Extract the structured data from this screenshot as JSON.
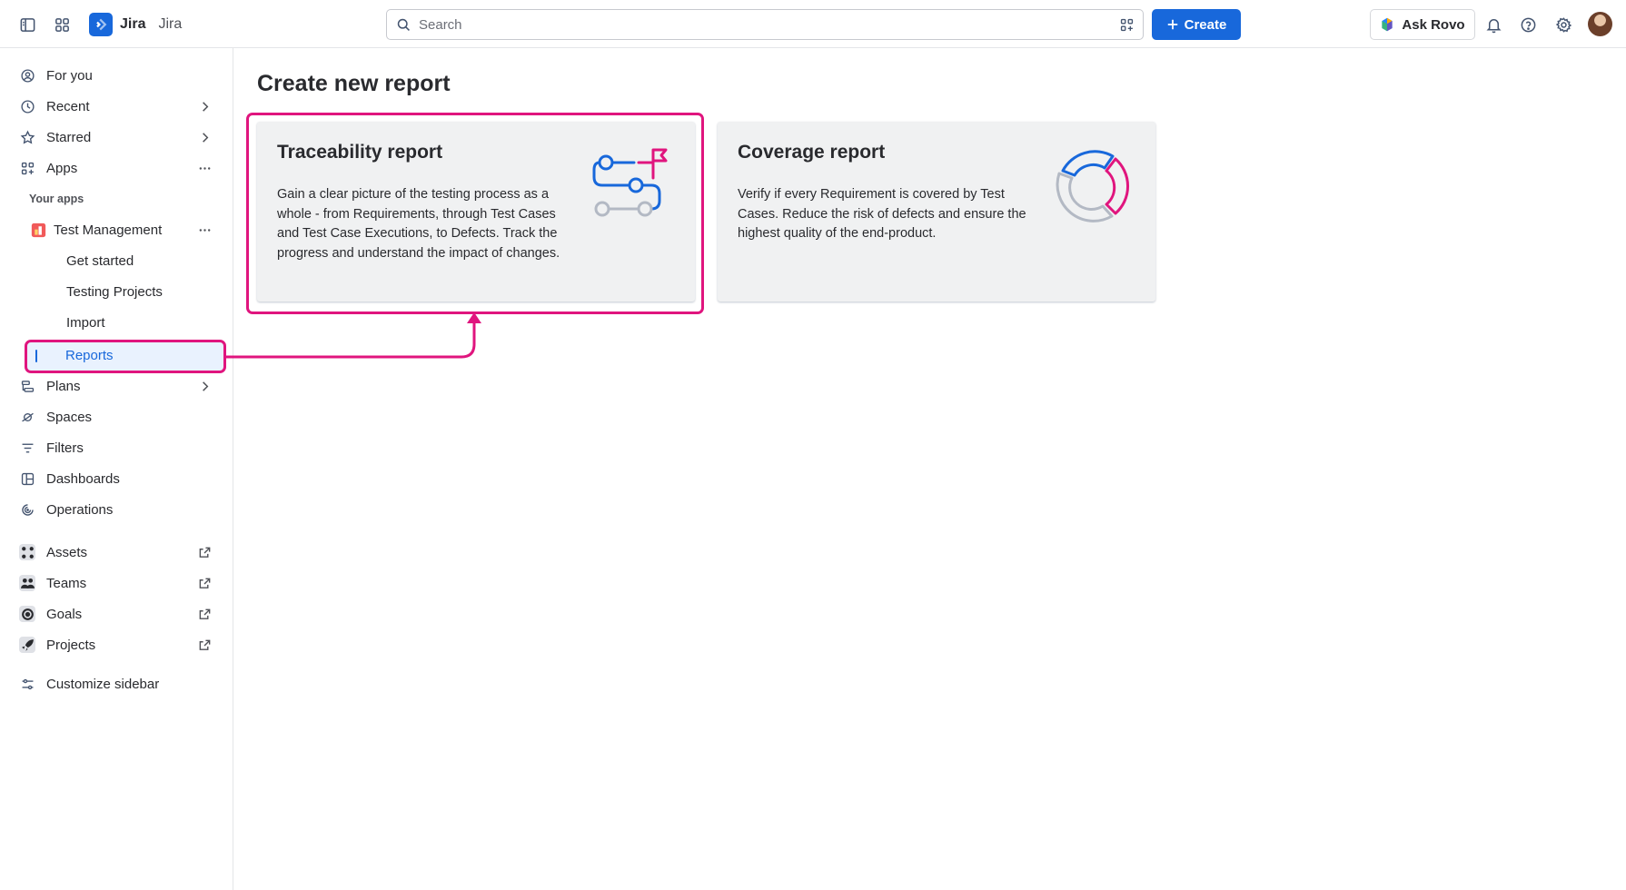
{
  "topbar": {
    "brand_name": "Jira",
    "brand_sub": "Jira",
    "search_placeholder": "Search",
    "create_label": "Create",
    "rovo_label": "Ask Rovo"
  },
  "sidebar": {
    "items": [
      {
        "label": "For you",
        "icon": "person-circle-icon"
      },
      {
        "label": "Recent",
        "icon": "clock-icon"
      },
      {
        "label": "Starred",
        "icon": "star-icon"
      },
      {
        "label": "Apps",
        "icon": "apps-icon"
      },
      {
        "label": "Plans",
        "icon": "plans-icon"
      },
      {
        "label": "Spaces",
        "icon": "spaces-icon"
      },
      {
        "label": "Filters",
        "icon": "filter-icon"
      },
      {
        "label": "Dashboards",
        "icon": "dashboard-icon"
      },
      {
        "label": "Operations",
        "icon": "operations-icon"
      },
      {
        "label": "Assets",
        "icon": "assets-icon"
      },
      {
        "label": "Teams",
        "icon": "teams-icon"
      },
      {
        "label": "Goals",
        "icon": "goals-icon"
      },
      {
        "label": "Projects",
        "icon": "rocket-icon"
      },
      {
        "label": "Customize sidebar",
        "icon": "sliders-icon"
      }
    ],
    "your_apps_label": "Your apps",
    "app_name": "Test Management",
    "app_subitems": [
      "Get started",
      "Testing Projects",
      "Import",
      "Reports"
    ]
  },
  "main": {
    "title": "Create new report",
    "cards": [
      {
        "title": "Traceability report",
        "description": "Gain a clear picture of the testing process as a whole - from Requirements, through Test Cases and Test Case Executions, to Defects. Track the progress and understand the impact of changes."
      },
      {
        "title": "Coverage report",
        "description": "Verify if every Requirement is covered by Test Cases. Reduce the risk of defects and ensure the highest quality of the end-product."
      }
    ]
  },
  "colors": {
    "brand_blue": "#1868db",
    "highlight_pink": "#e0157e",
    "selected_bg": "#e9f2fe"
  }
}
